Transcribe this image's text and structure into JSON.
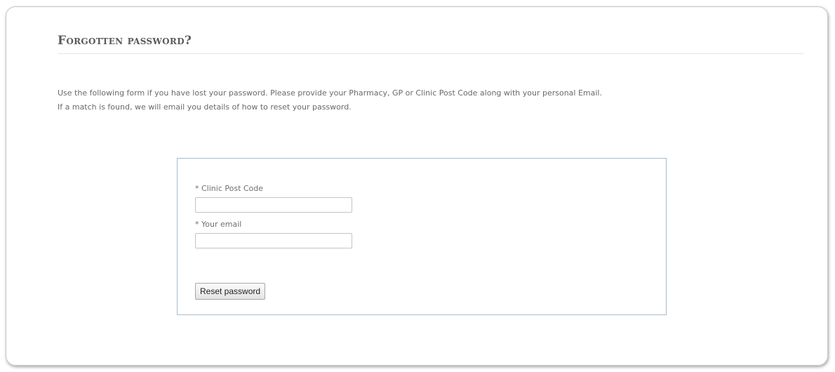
{
  "page": {
    "heading": "Forgotten password?",
    "intro_line_1": "Use the following form if you have lost your password. Please provide your Pharmacy, GP or Clinic Post Code along with your personal Email.",
    "intro_line_2": "If a match is found, we will email you details of how to reset your password."
  },
  "form": {
    "postcode_label": "* Clinic Post Code",
    "postcode_value": "",
    "email_label": "* Your email",
    "email_value": "",
    "submit_label": "Reset password"
  },
  "colors": {
    "form_border": "#a9bcd2",
    "heading_text": "#5a5a5a",
    "body_text": "#6a6a6a"
  }
}
